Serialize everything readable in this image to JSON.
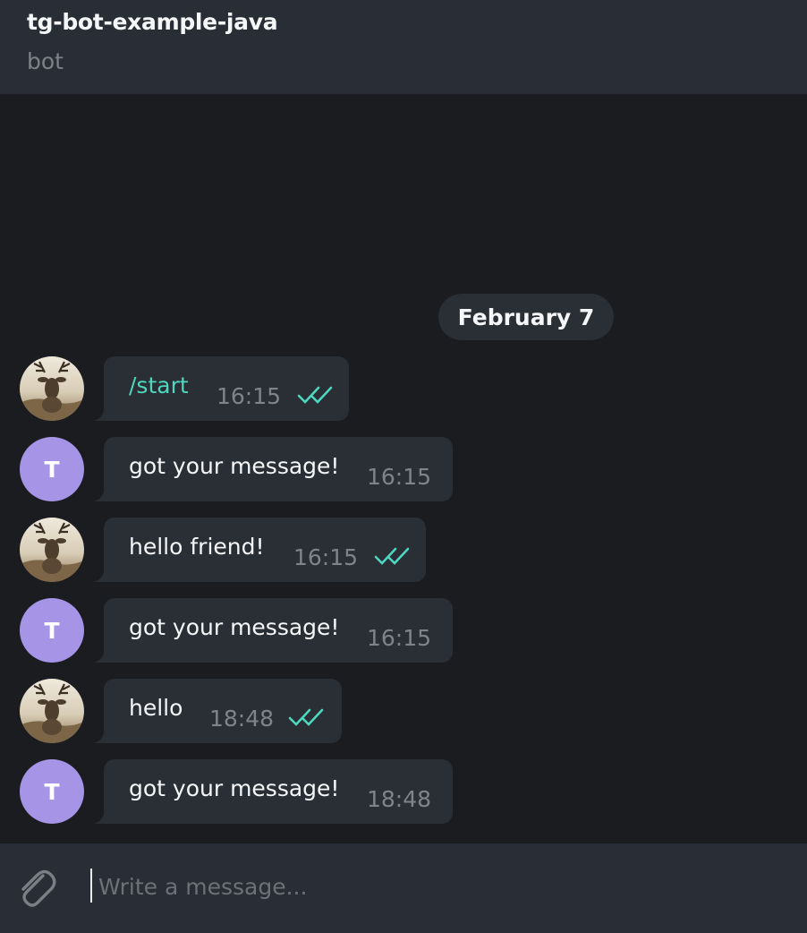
{
  "header": {
    "title": "tg-bot-example-java",
    "subtitle": "bot"
  },
  "date_separator": "February 7",
  "messages": [
    {
      "sender": "user",
      "text": "/start",
      "time": "16:15",
      "read": true,
      "is_command": true
    },
    {
      "sender": "bot",
      "avatar_letter": "T",
      "text": "got your message!",
      "time": "16:15",
      "read": false
    },
    {
      "sender": "user",
      "text": "hello friend!",
      "time": "16:15",
      "read": true
    },
    {
      "sender": "bot",
      "avatar_letter": "T",
      "text": "got your message!",
      "time": "16:15",
      "read": false
    },
    {
      "sender": "user",
      "text": "hello",
      "time": "18:48",
      "read": true
    },
    {
      "sender": "bot",
      "avatar_letter": "T",
      "text": "got your message!",
      "time": "18:48",
      "read": false
    }
  ],
  "composer": {
    "placeholder": "Write a message...",
    "value": ""
  },
  "colors": {
    "background": "#1b1c20",
    "header": "#292d35",
    "bubble": "#2a2e35",
    "accent": "#4fd6bf",
    "bot_avatar": "#a695e7"
  },
  "icons": {
    "attach": "paperclip-icon",
    "read_status": "double-check-icon",
    "user_avatar": "deer-photo"
  }
}
